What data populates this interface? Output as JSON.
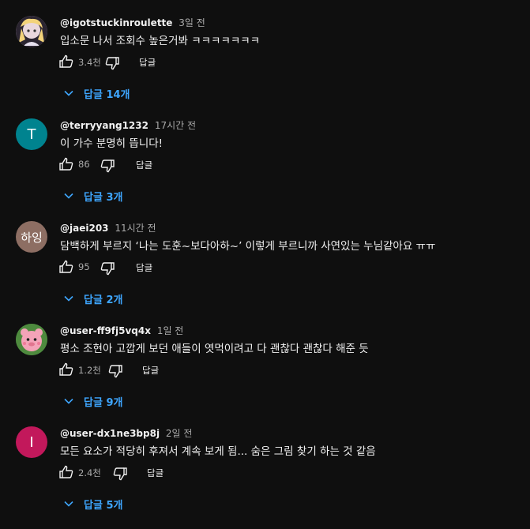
{
  "colors": {
    "background": "#0f0f0f",
    "link": "#3ea6ff",
    "muted": "#aaaaaa"
  },
  "comments": [
    {
      "author": "@igotstuckinroulette",
      "time": "3일 전",
      "text": "입소문 나서 조회수 높은거봐 ㅋㅋㅋㅋㅋㅋㅋ",
      "likes": "3.4천",
      "reply_label": "답글",
      "replies_label": "답글 14개",
      "avatar": {
        "kind": "image",
        "letter": "",
        "color": "#c9b7c7"
      }
    },
    {
      "author": "@terryyang1232",
      "time": "17시간 전",
      "text": "이 가수 분명히 뜹니다!",
      "likes": "86",
      "reply_label": "답글",
      "replies_label": "답글 3개",
      "avatar": {
        "kind": "letter",
        "letter": "T",
        "color": "#00838f"
      }
    },
    {
      "author": "@jaei203",
      "time": "11시간 전",
      "text": "담백하게 부르지 ‘나는 도훈~보다아하~’ 이렇게 부르니까 사연있는 누님같아요 ㅠㅠ",
      "likes": "95",
      "reply_label": "답글",
      "replies_label": "답글 2개",
      "avatar": {
        "kind": "letter",
        "letter": "하잉",
        "color": "#8d6e63"
      }
    },
    {
      "author": "@user-ff9fj5vq4x",
      "time": "1일 전",
      "text": "평소 조현아 고깝게 보던 애들이 엿먹이려고 다 괜찮다 괜찮다 해준 듯",
      "likes": "1.2천",
      "reply_label": "답글",
      "replies_label": "답글 9개",
      "avatar": {
        "kind": "image",
        "letter": "",
        "color": "#3b7a3a"
      }
    },
    {
      "author": "@user-dx1ne3bp8j",
      "time": "2일 전",
      "text": "모든 요소가 적당히 후져서 계속 보게 됨... 숨은 그림 찾기 하는 것 같음",
      "likes": "2.4천",
      "reply_label": "답글",
      "replies_label": "답글 5개",
      "avatar": {
        "kind": "letter",
        "letter": "I",
        "color": "#c2185b"
      }
    }
  ]
}
